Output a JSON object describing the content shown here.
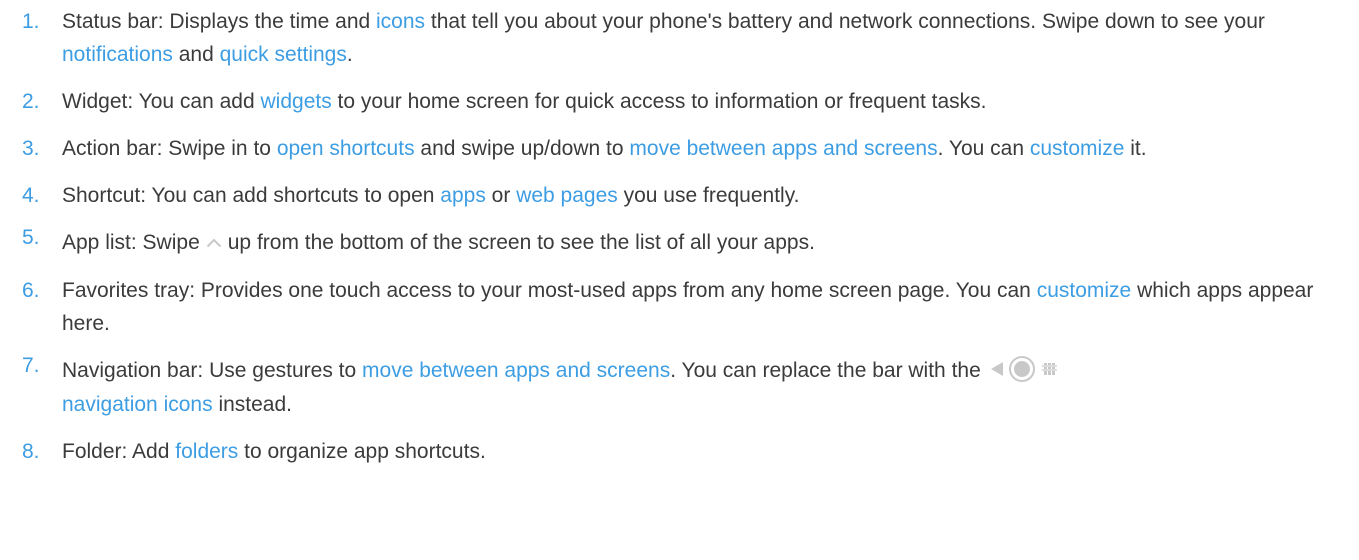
{
  "items": [
    {
      "number": "1.",
      "label": "Status bar",
      "parts": [
        " Displays the time and ",
        "icons",
        " that tell you about your phone's battery and network connections. Swipe down to see your ",
        "notifications",
        " and ",
        "quick settings",
        "."
      ]
    },
    {
      "number": "2.",
      "label": "Widget",
      "parts": [
        " You can add ",
        "widgets",
        " to your home screen for quick access to information or frequent tasks."
      ]
    },
    {
      "number": "3.",
      "label": "Action bar",
      "parts": [
        " Swipe in to ",
        "open shortcuts",
        " and swipe up/down to ",
        "move between apps and screens",
        ". You can ",
        "customize",
        " it."
      ]
    },
    {
      "number": "4.",
      "label": "Shortcut",
      "parts": [
        " You can add shortcuts to open ",
        "apps",
        " or ",
        "web pages",
        " you use frequently."
      ]
    },
    {
      "number": "5.",
      "label": "App list",
      "parts": [
        " Swipe",
        "up from the bottom of the screen to see the list of all your apps."
      ]
    },
    {
      "number": "6.",
      "label": "Favorites tray",
      "parts": [
        " Provides one touch access to your most-used apps from any home screen page. You can ",
        "customize",
        " which apps appear here."
      ]
    },
    {
      "number": "7.",
      "label": "Navigation bar",
      "parts": [
        " Use gestures to ",
        "move between apps and screens",
        ". You can replace the bar with the",
        "navigation icons",
        " instead."
      ]
    },
    {
      "number": "8.",
      "label": "Folder",
      "parts": [
        " Add ",
        "folders",
        " to organize app shortcuts."
      ]
    }
  ],
  "colors": {
    "link": "#3d9de3",
    "text": "#3b3b3b",
    "icon_gray": "#c8c8c8"
  },
  "icons": {
    "swipe_up": "caret-up-icon",
    "nav_back": "back-triangle-icon",
    "nav_home": "home-circle-icon",
    "nav_recents": "recents-icon"
  }
}
